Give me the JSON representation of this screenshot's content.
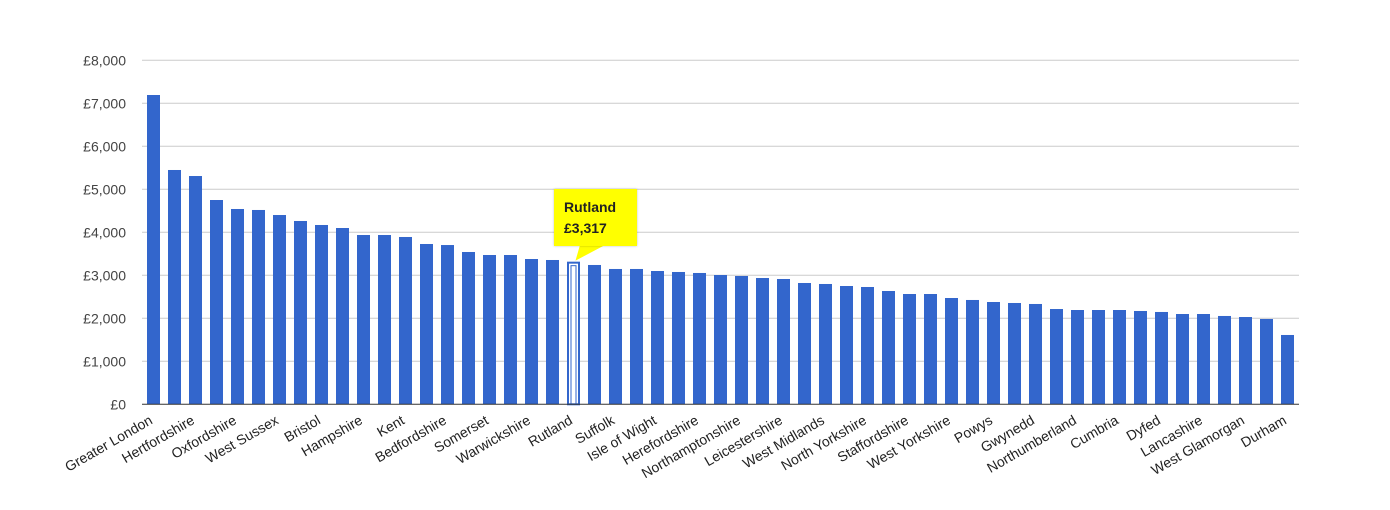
{
  "chart_data": {
    "type": "bar",
    "title": "",
    "xlabel": "",
    "ylabel": "",
    "ylim": [
      0,
      8000
    ],
    "yticks": [
      0,
      1000,
      2000,
      3000,
      4000,
      5000,
      6000,
      7000,
      8000
    ],
    "ytick_labels": [
      "£0",
      "£1,000",
      "£2,000",
      "£3,000",
      "£4,000",
      "£5,000",
      "£6,000",
      "£7,000",
      "£8,000"
    ],
    "grid": true,
    "legend": "none",
    "bar_color": "#3366cc",
    "categories": [
      "Greater London",
      "",
      "Hertfordshire",
      "",
      "Oxfordshire",
      "",
      "West Sussex",
      "",
      "Bristol",
      "",
      "Hampshire",
      "",
      "Kent",
      "",
      "Bedfordshire",
      "",
      "Somerset",
      "",
      "Warwickshire",
      "",
      "Rutland",
      "",
      "Suffolk",
      "",
      "Isle of Wight",
      "",
      "Herefordshire",
      "",
      "Northamptonshire",
      "",
      "Leicestershire",
      "",
      "West Midlands",
      "",
      "North Yorkshire",
      "",
      "Staffordshire",
      "",
      "West Yorkshire",
      "",
      "Powys",
      "",
      "Gwynedd",
      "",
      "Northumberland",
      "",
      "Cumbria",
      "",
      "Dyfed",
      "",
      "Lancashire",
      "",
      "West Glamorgan",
      "",
      "Durham"
    ],
    "values": [
      7193,
      5449,
      5309,
      4751,
      4542,
      4519,
      4402,
      4263,
      4170,
      4100,
      3937,
      3937,
      3891,
      3728,
      3704,
      3542,
      3472,
      3472,
      3379,
      3356,
      3317,
      3240,
      3147,
      3147,
      3100,
      3077,
      3054,
      3007,
      2984,
      2937,
      2914,
      2821,
      2798,
      2751,
      2728,
      2635,
      2565,
      2565,
      2472,
      2426,
      2379,
      2356,
      2333,
      2216,
      2193,
      2193,
      2193,
      2170,
      2147,
      2100,
      2100,
      2054,
      2030,
      1984,
      1612
    ],
    "highlighted_index": 20,
    "tooltip": {
      "title": "Rutland",
      "value": "£3,317",
      "background": "#ffff00"
    }
  }
}
